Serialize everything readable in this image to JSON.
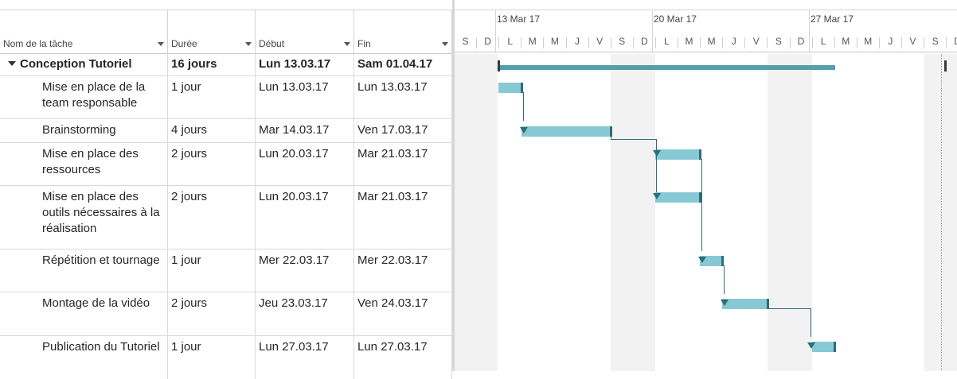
{
  "columns": {
    "name": "Nom de la tâche",
    "duration": "Durée",
    "start": "Début",
    "end": "Fin"
  },
  "tasks": [
    {
      "name": "Conception Tutoriel",
      "duration": "16 jours",
      "start": "Lun 13.03.17",
      "end": "Sam 01.04.17",
      "summary": true
    },
    {
      "name": "Mise en place de la team responsable",
      "duration": "1 jour",
      "start": "Lun 13.03.17",
      "end": "Lun 13.03.17"
    },
    {
      "name": "Brainstorming",
      "duration": "4 jours",
      "start": "Mar 14.03.17",
      "end": "Ven 17.03.17"
    },
    {
      "name": "Mise en place des ressources",
      "duration": "2 jours",
      "start": "Lun 20.03.17",
      "end": "Mar 21.03.17"
    },
    {
      "name": "Mise en place des outils nécessaires à la réalisation",
      "duration": "2 jours",
      "start": "Lun 20.03.17",
      "end": "Mar 21.03.17"
    },
    {
      "name": "Répétition et tournage",
      "duration": "1 jour",
      "start": "Mer 22.03.17",
      "end": "Mer 22.03.17"
    },
    {
      "name": "Montage de la vidéo",
      "duration": "2 jours",
      "start": "Jeu 23.03.17",
      "end": "Ven 24.03.17"
    },
    {
      "name": "Publication du Tutoriel",
      "duration": "1 jour",
      "start": "Lun 27.03.17",
      "end": "Lun 27.03.17"
    }
  ],
  "timeline": {
    "weeks": [
      "13 Mar 17",
      "20 Mar 17",
      "27 Mar 17"
    ],
    "days": [
      "S",
      "D",
      "L",
      "M",
      "M",
      "J",
      "V",
      "S",
      "D",
      "L",
      "M",
      "M",
      "J",
      "V",
      "S",
      "D",
      "L",
      "M",
      "M",
      "J",
      "V",
      "S",
      "D"
    ]
  },
  "colors": {
    "bar_fill": "#86c9d4",
    "summary_bar": "#53a0ac",
    "link": "#2f6c78",
    "weekend": "#f2f2f2"
  }
}
